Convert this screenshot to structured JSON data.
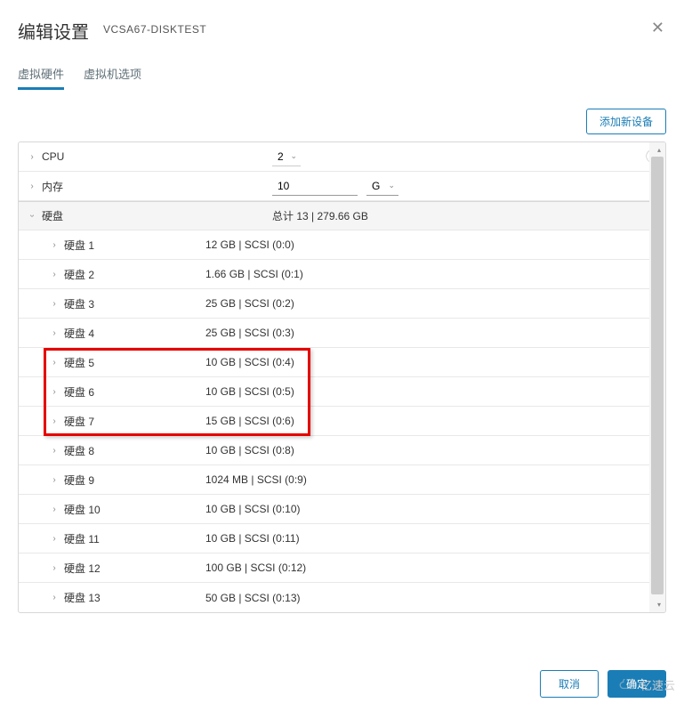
{
  "dialog": {
    "title": "编辑设置",
    "vm_name": "VCSA67-DISKTEST"
  },
  "tabs": {
    "hardware": "虚拟硬件",
    "options": "虚拟机选项"
  },
  "toolbar": {
    "add_device": "添加新设备"
  },
  "cpu": {
    "label": "CPU",
    "value": "2"
  },
  "memory": {
    "label": "内存",
    "value": "10",
    "unit": "GB"
  },
  "disk_group": {
    "label": "硬盘",
    "summary": "总计 13 | 279.66 GB"
  },
  "disks": [
    {
      "label": "硬盘 1",
      "detail": "12 GB | SCSI (0:0)"
    },
    {
      "label": "硬盘 2",
      "detail": "1.66 GB | SCSI (0:1)"
    },
    {
      "label": "硬盘 3",
      "detail": "25 GB | SCSI (0:2)"
    },
    {
      "label": "硬盘 4",
      "detail": "25 GB | SCSI (0:3)"
    },
    {
      "label": "硬盘 5",
      "detail": "10 GB | SCSI (0:4)"
    },
    {
      "label": "硬盘 6",
      "detail": "10 GB | SCSI (0:5)"
    },
    {
      "label": "硬盘 7",
      "detail": "15 GB | SCSI (0:6)"
    },
    {
      "label": "硬盘 8",
      "detail": "10 GB | SCSI (0:8)"
    },
    {
      "label": "硬盘 9",
      "detail": "1024 MB | SCSI (0:9)"
    },
    {
      "label": "硬盘 10",
      "detail": "10 GB | SCSI (0:10)"
    },
    {
      "label": "硬盘 11",
      "detail": "10 GB | SCSI (0:11)"
    },
    {
      "label": "硬盘 12",
      "detail": "100 GB | SCSI (0:12)"
    },
    {
      "label": "硬盘 13",
      "detail": "50 GB | SCSI (0:13)"
    }
  ],
  "footer": {
    "cancel": "取消",
    "ok": "确定"
  },
  "watermark": "亿速云"
}
